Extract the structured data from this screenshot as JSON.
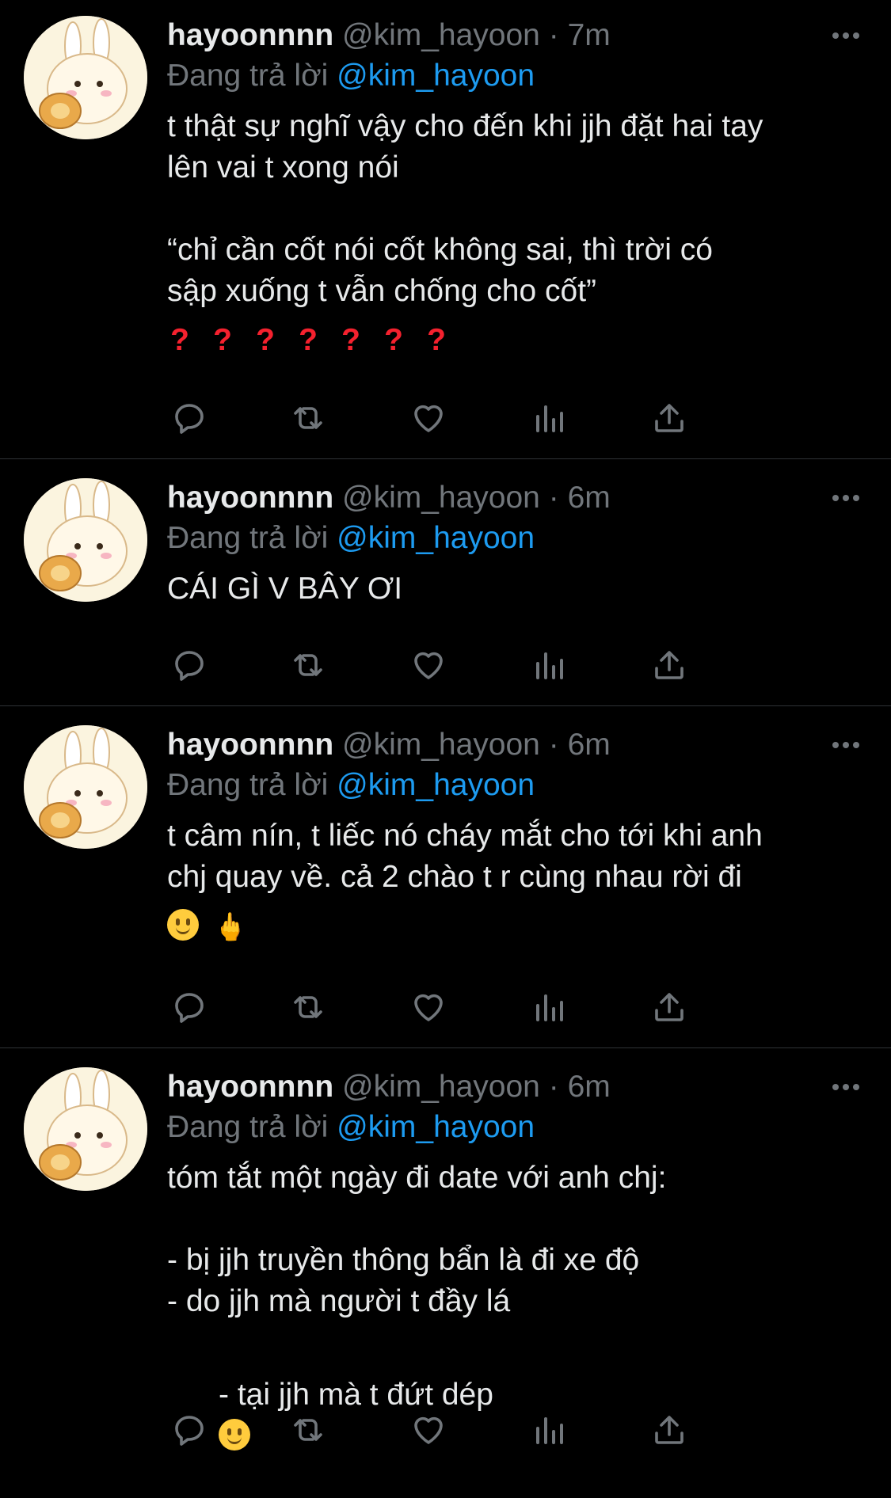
{
  "tweets": [
    {
      "name": "hayoonnnn",
      "handle": "@kim_hayoon",
      "dot": "·",
      "time": "7m",
      "reply_prefix": "Đang trả lời",
      "reply_to": "@kim_hayoon",
      "body": "t thật sự nghĩ vậy cho đến khi jjh đặt hai tay\nlên vai t xong nói\n\n“chỉ cần cốt nói cốt không sai, thì trời có\nsập xuống t vẫn chống cho cốt”",
      "emoji": "❓❓❓❓❓❓❓"
    },
    {
      "name": "hayoonnnn",
      "handle": "@kim_hayoon",
      "dot": "·",
      "time": "6m",
      "reply_prefix": "Đang trả lời",
      "reply_to": "@kim_hayoon",
      "body": "CÁI GÌ V BÂY ƠI"
    },
    {
      "name": "hayoonnnn",
      "handle": "@kim_hayoon",
      "dot": "·",
      "time": "6m",
      "reply_prefix": "Đang trả lời",
      "reply_to": "@kim_hayoon",
      "body": "t câm nín, t liếc nó cháy mắt cho tới khi anh\nchj quay về. cả 2 chào t r cùng nhau rời đi",
      "emoji": "🙂🖕"
    },
    {
      "name": "hayoonnnn",
      "handle": "@kim_hayoon",
      "dot": "·",
      "time": "6m",
      "reply_prefix": "Đang trả lời",
      "reply_to": "@kim_hayoon",
      "body": "tóm tắt một ngày đi date với anh chj:\n\n- bị jjh truyền thông bẩn là đi xe độ\n- do jjh mà người t đầy lá",
      "body_last": "- tại jjh mà t đứt dép",
      "emoji": "🙂"
    }
  ],
  "icons": {
    "reply": "reply-icon",
    "retweet": "retweet-icon",
    "like": "like-icon",
    "views": "views-icon",
    "share": "share-icon",
    "more": "more-icon"
  },
  "colors": {
    "background": "#000000",
    "text": "#e7e9ea",
    "muted": "#71767b",
    "link": "#1d9bf0",
    "divider": "#2f3336"
  }
}
